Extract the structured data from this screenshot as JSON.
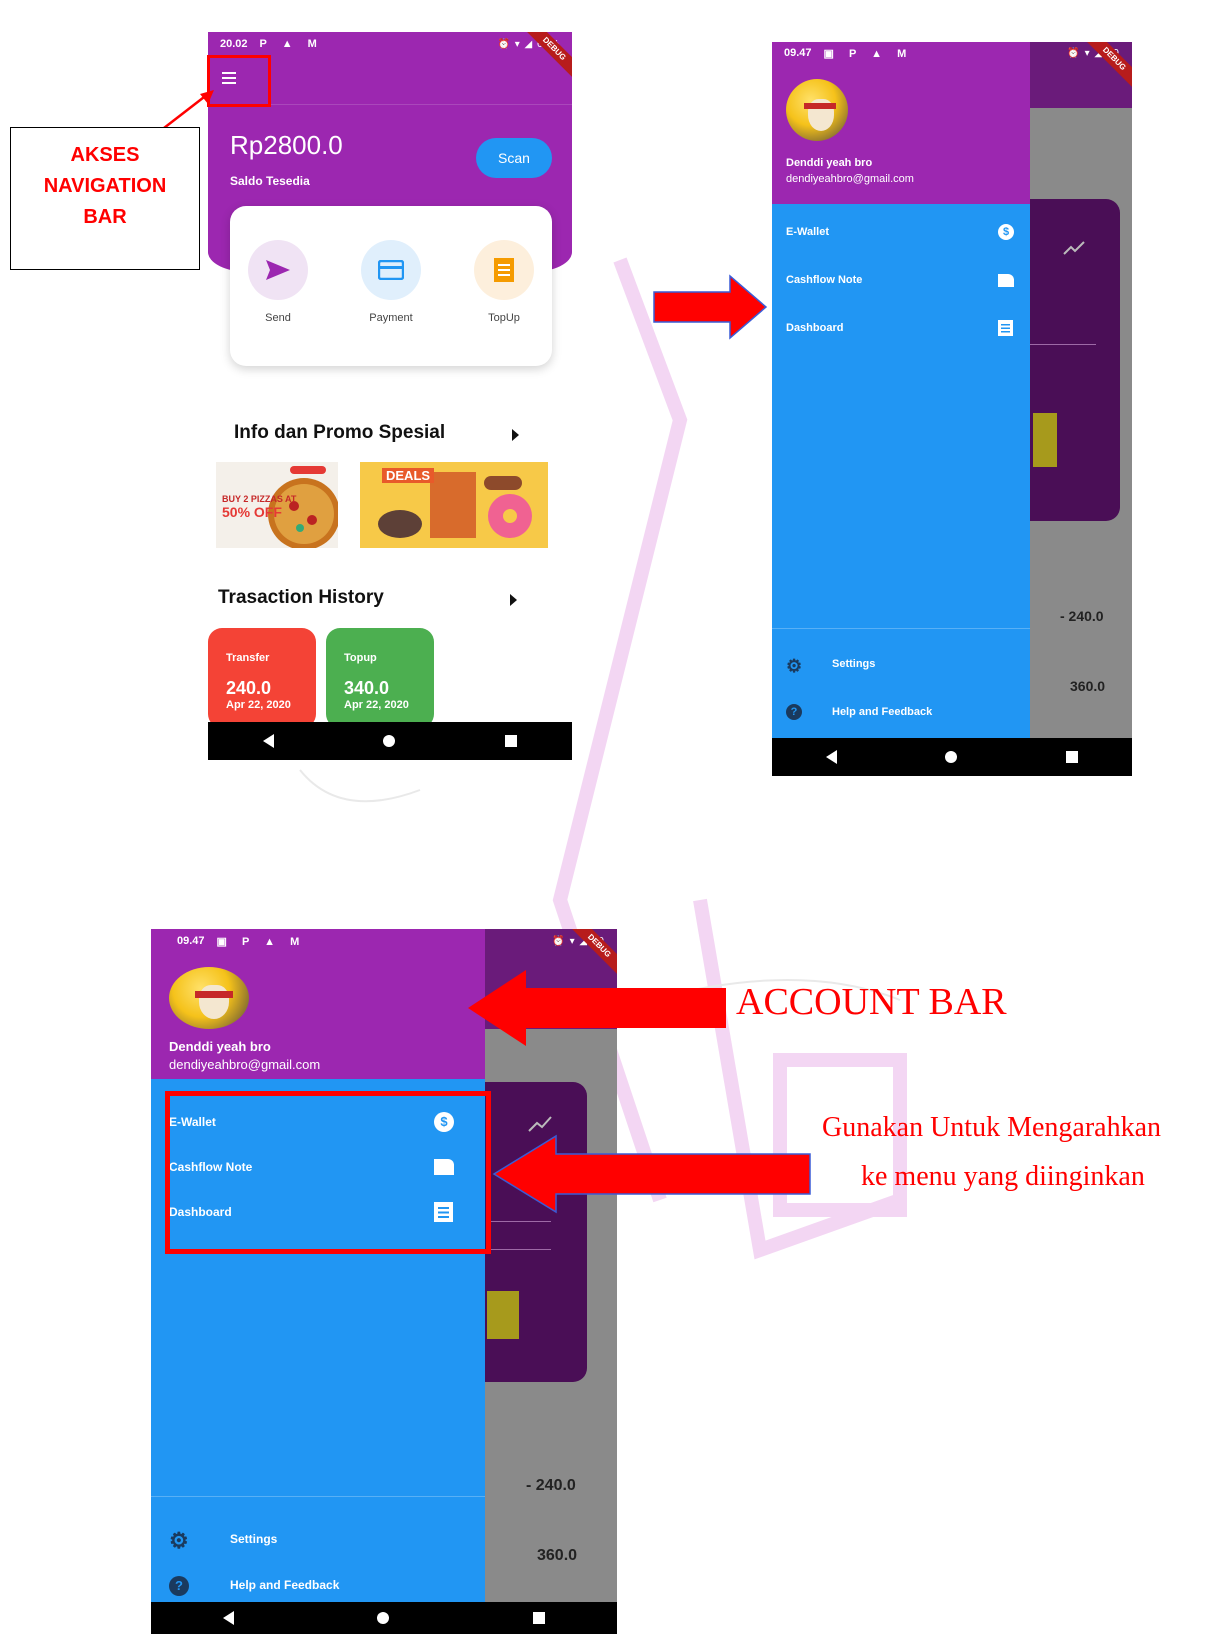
{
  "main_screen": {
    "status_time": "20.02",
    "status_glyphs": "P ▲ M",
    "status_right": "⏰ ▾ ◢ 69%",
    "debug_label": "DEBUG",
    "balance": "Rp2800.0",
    "balance_label": "Saldo Tesedia",
    "scan_label": "Scan",
    "actions": [
      {
        "label": "Send",
        "icon": "send-icon",
        "bg": "#f0e3f4",
        "fg": "#9c27b0"
      },
      {
        "label": "Payment",
        "icon": "card-icon",
        "bg": "#e0effc",
        "fg": "#2196f3"
      },
      {
        "label": "TopUp",
        "icon": "receipt-icon",
        "bg": "#fdefdc",
        "fg": "#f59b00"
      }
    ],
    "promo_title": "Info dan Promo Spesial",
    "promo_pizza_lines": [
      "BUY 2 PIZZAS AT",
      "50% OFF"
    ],
    "promo_deals_label": "DEALS",
    "history_title": "Trasaction History",
    "transactions": [
      {
        "type": "Transfer",
        "value": "240.0",
        "date": "Apr 22, 2020",
        "color": "#f44336"
      },
      {
        "type": "Topup",
        "value": "340.0",
        "date": "Apr 22, 2020",
        "color": "#4caf50"
      }
    ]
  },
  "drawer_screen": {
    "status_time": "09.47",
    "status_glyphs": "▣ P ▲ M",
    "status_right": "⏰ ▾ ◢ 29",
    "debug_label": "DEBUG",
    "account_name": "Denddi yeah bro",
    "account_email": "dendiyeahbro@gmail.com",
    "menu": [
      {
        "label": "E-Wallet",
        "icon": "dollar-icon"
      },
      {
        "label": "Cashflow Note",
        "icon": "note-icon"
      },
      {
        "label": "Dashboard",
        "icon": "list-icon"
      }
    ],
    "footer": [
      {
        "label": "Settings",
        "icon": "gear-icon"
      },
      {
        "label": "Help and Feedback",
        "icon": "help-icon"
      }
    ],
    "background_values": [
      "- 240.0",
      "360.0"
    ]
  },
  "zoom_screen": {
    "menu": [
      {
        "label": "E-Wallet"
      },
      {
        "label": "Cashflow Note"
      },
      {
        "label": "Dashboard"
      }
    ]
  },
  "annotations": {
    "nav_bar_note": [
      "AKSES",
      "NAVIGATION",
      "BAR"
    ],
    "account_bar": "ACCOUNT BAR",
    "menu_note_line1": "Gunakan  Untuk Mengarahkan",
    "menu_note_line2": "ke menu yang diinginkan"
  },
  "colors": {
    "purple": "#9c27b0",
    "blue": "#2196f3",
    "annotation_red": "#ff0000"
  }
}
